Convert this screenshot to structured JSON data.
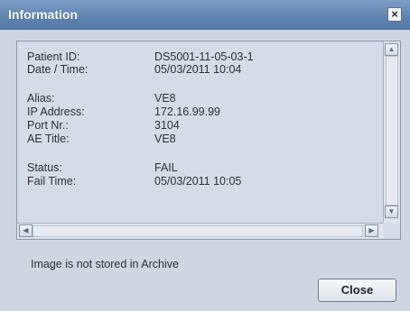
{
  "window": {
    "title": "Information",
    "close_icon_glyph": "×"
  },
  "details": {
    "rows": [
      {
        "label": "Patient ID:",
        "value": "DS5001-11-05-03-1"
      },
      {
        "label": "Date / Time:",
        "value": "05/03/2011 10:04"
      },
      {
        "label": "Alias:",
        "value": "VE8"
      },
      {
        "label": "IP Address:",
        "value": "172.16.99.99"
      },
      {
        "label": "Port Nr.:",
        "value": "3104"
      },
      {
        "label": "AE Title:",
        "value": "VE8"
      },
      {
        "label": "Status:",
        "value": "FAIL"
      },
      {
        "label": "Fail Time:",
        "value": "05/03/2011 10:05"
      }
    ]
  },
  "icons": {
    "scroll_up": "chevron-up-icon",
    "scroll_down": "chevron-down-icon",
    "scroll_left": "chevron-left-icon",
    "scroll_right": "chevron-right-icon"
  },
  "message": "Image is not stored in Archive",
  "buttons": {
    "close_label": "Close"
  }
}
